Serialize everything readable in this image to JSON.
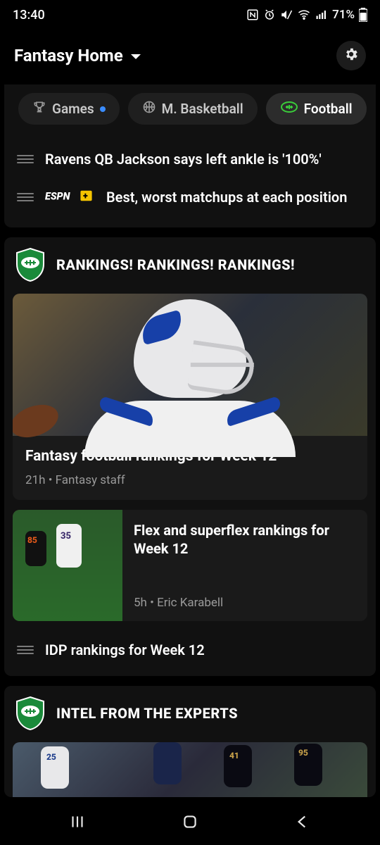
{
  "status": {
    "time": "13:40",
    "battery": "71%"
  },
  "header": {
    "title": "Fantasy Home"
  },
  "tabs": {
    "games": "Games",
    "mbasketball": "M. Basketball",
    "football": "Football"
  },
  "news": [
    {
      "headline": "Ravens QB Jackson says left ankle is '100%'",
      "espnplus": false
    },
    {
      "headline": "Best, worst matchups at each position",
      "espnplus": true
    }
  ],
  "rankings": {
    "title": "RANKINGS! RANKINGS! RANKINGS!",
    "hero": {
      "title": "Fantasy football rankings for Week 12",
      "age": "21h",
      "author": "Fantasy staff"
    },
    "item2": {
      "title": "Flex and superflex rankings for Week 12",
      "age": "5h",
      "author": "Eric Karabell"
    },
    "item3": {
      "headline": "IDP rankings for Week 12"
    }
  },
  "intel": {
    "title": "INTEL FROM THE EXPERTS"
  }
}
